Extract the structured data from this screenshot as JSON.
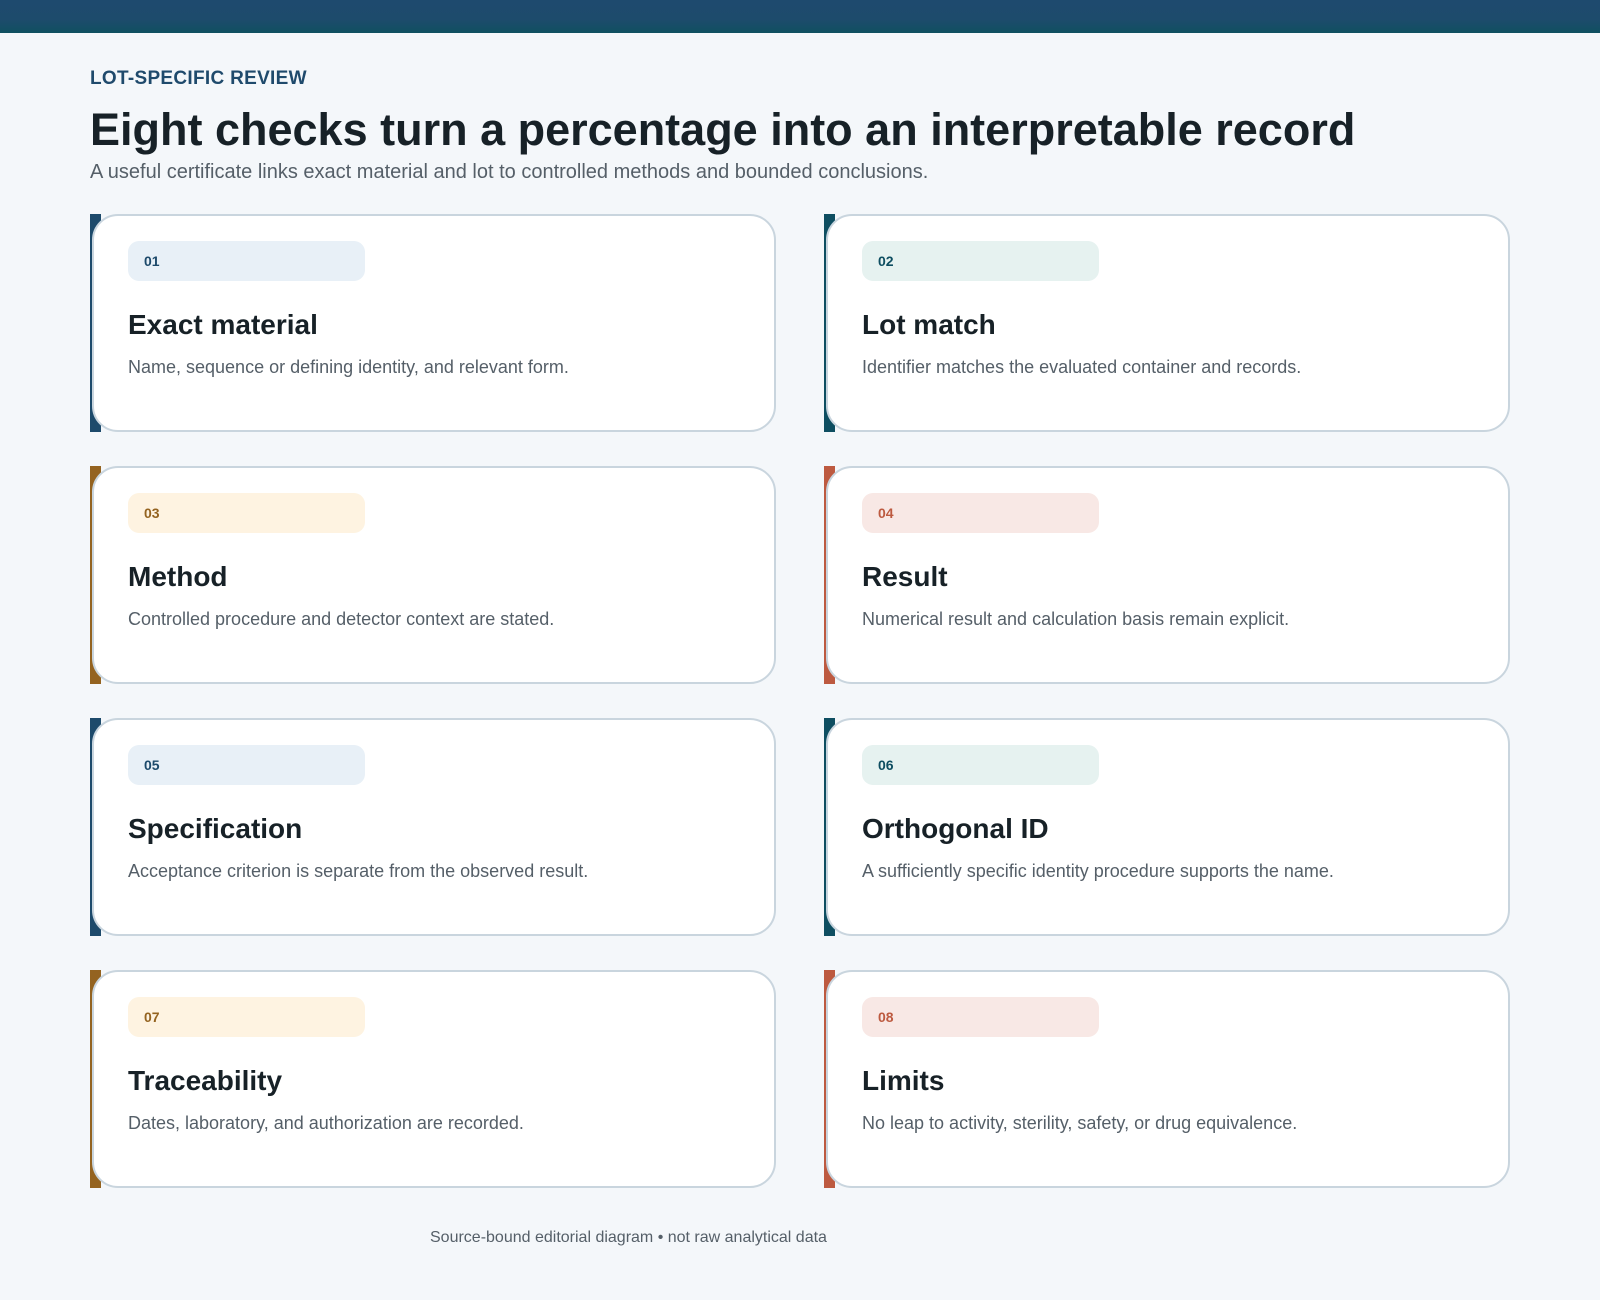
{
  "header": {
    "kicker": "LOT-SPECIFIC REVIEW",
    "title": "Eight checks turn a percentage into an interpretable record",
    "subtitle": "A useful certificate links exact material and lot to controlled methods and bounded conclusions."
  },
  "colors": {
    "navy": "#1d4a6b",
    "teal": "#0e4e61",
    "ochre": "#946320",
    "rust": "#bd5a40",
    "navy_tint": "#e8f0f7",
    "teal_tint": "#e6f2f0",
    "ochre_tint": "#fef3e1",
    "rust_tint": "#f8e8e5"
  },
  "checks": [
    {
      "number": "01",
      "title": "Exact material",
      "description": "Name, sequence or defining identity, and relevant form."
    },
    {
      "number": "02",
      "title": "Lot match",
      "description": "Identifier matches the evaluated container and records."
    },
    {
      "number": "03",
      "title": "Method",
      "description": "Controlled procedure and detector context are stated."
    },
    {
      "number": "04",
      "title": "Result",
      "description": "Numerical result and calculation basis remain explicit."
    },
    {
      "number": "05",
      "title": "Specification",
      "description": "Acceptance criterion is separate from the observed result."
    },
    {
      "number": "06",
      "title": "Orthogonal ID",
      "description": "A sufficiently specific identity procedure supports the name."
    },
    {
      "number": "07",
      "title": "Traceability",
      "description": "Dates, laboratory, and authorization are recorded."
    },
    {
      "number": "08",
      "title": "Limits",
      "description": "No leap to activity, sterility, safety, or drug equivalence."
    }
  ],
  "footer": {
    "note": "Source-bound editorial diagram • not raw analytical data"
  }
}
